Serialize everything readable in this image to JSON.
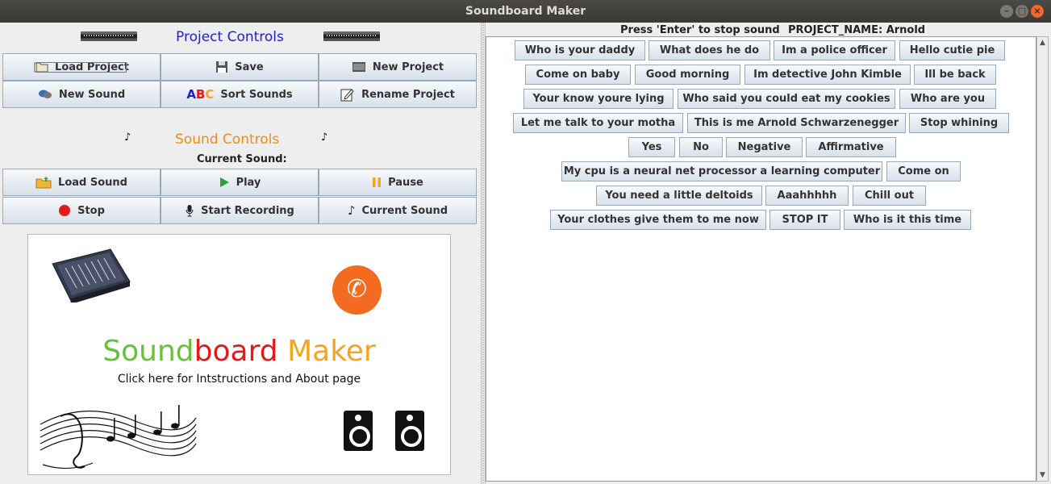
{
  "window": {
    "title": "Soundboard Maker"
  },
  "project_controls": {
    "title": "Project Controls",
    "buttons": {
      "load_project": "Load Project",
      "save": "Save",
      "new_project": "New Project",
      "new_sound": "New Sound",
      "sort_sounds": "Sort Sounds",
      "sort_icon_text": "ABC",
      "rename_project": "Rename Project"
    }
  },
  "sound_controls": {
    "title": "Sound Controls",
    "current_sound_label": "Current Sound:",
    "buttons": {
      "load_sound": "Load Sound",
      "play": "Play",
      "pause": "Pause",
      "stop": "Stop",
      "start_recording": "Start Recording",
      "current_sound": "Current Sound"
    }
  },
  "logo_panel": {
    "title_word1": "Sound",
    "title_word2": "board",
    "title_word3": "Maker",
    "subtitle": "Click here for Intstructions and About page"
  },
  "right_header": {
    "hint": "Press 'Enter' to stop sound",
    "project_name": "PROJECT_NAME: Arnold"
  },
  "sound_buttons": [
    [
      "Who is your daddy",
      "What does he do",
      "Im a police officer",
      "Hello cutie pie"
    ],
    [
      "Come on baby",
      "Good morning",
      "Im detective John Kimble",
      "Ill be back"
    ],
    [
      "Your know youre lying",
      "Who said you could eat my cookies",
      "Who are you"
    ],
    [
      "Let me talk to your motha",
      "This is me Arnold Schwarzenegger",
      "Stop whining"
    ],
    [
      "Yes",
      "No",
      "Negative",
      "Affirmative"
    ],
    [
      "My cpu is a neural net processor a learning computer",
      "Come on"
    ],
    [
      "You need a little deltoids",
      "Aaahhhhh",
      "Chill out"
    ],
    [
      "Your clothes give them to me now",
      "STOP IT",
      "Who is it this time"
    ]
  ],
  "colors": {
    "project_title": "#1f1fd6",
    "sound_title": "#f28b14",
    "logo_sound": "#66c23a",
    "logo_board": "#e11b1b",
    "logo_maker": "#f5a41f",
    "phone": "#f36b21"
  },
  "icons": {
    "load_project": "folder-icon",
    "save": "floppy-disk-icon",
    "new_project": "keyboard-icon",
    "new_sound": "speech-bubbles-icon",
    "rename_project": "edit-icon",
    "load_sound": "folder-upload-icon",
    "play": "play-icon",
    "pause": "pause-icon",
    "stop": "stop-icon",
    "start_recording": "microphone-icon",
    "current_sound": "music-note-icon"
  }
}
